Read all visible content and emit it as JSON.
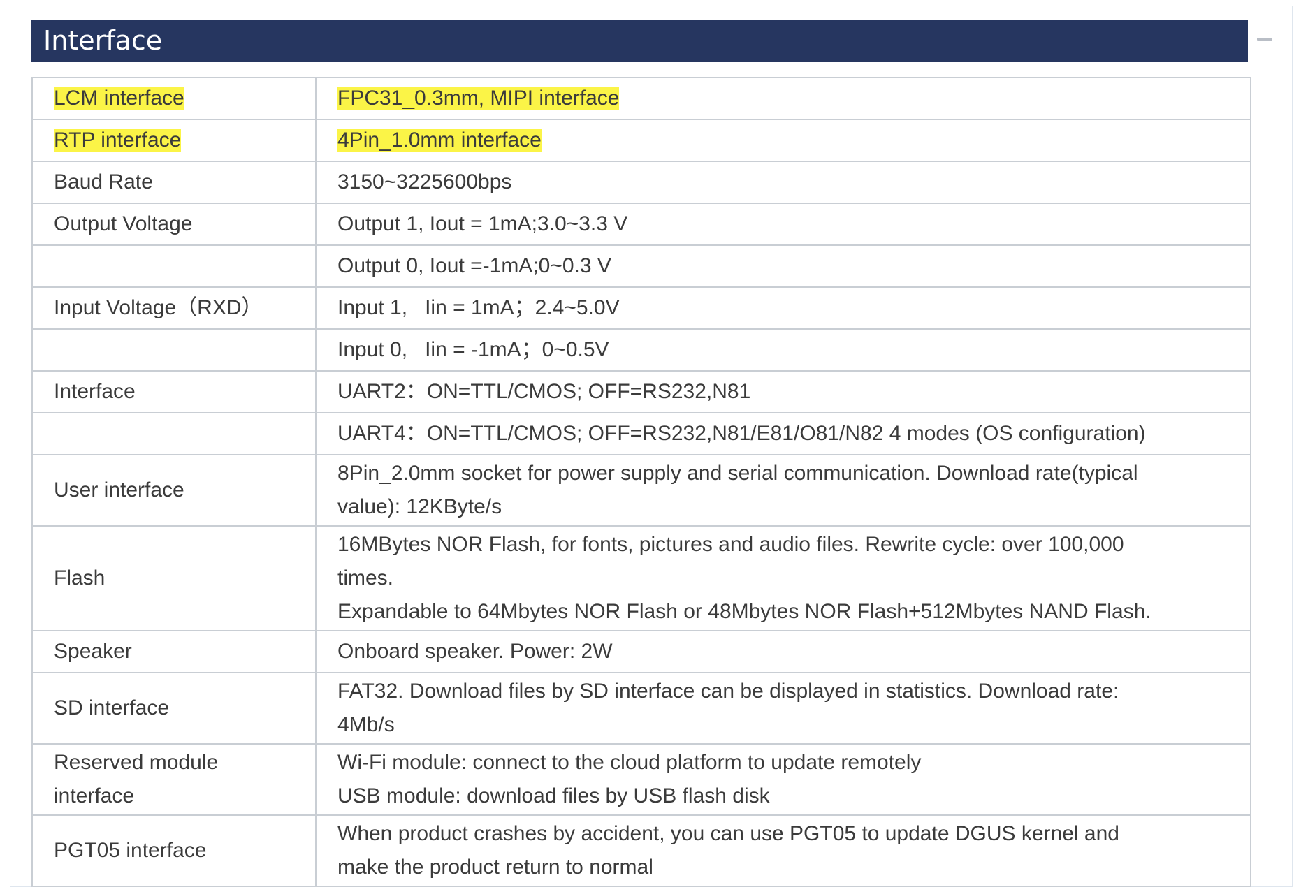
{
  "section": {
    "title": "Interface",
    "collapse_icon": "minus-icon"
  },
  "rows": [
    {
      "label": "LCM interface",
      "value": "FPC31_0.3mm, MIPI interface",
      "highlight": true
    },
    {
      "label": "RTP interface",
      "value": "4Pin_1.0mm interface",
      "highlight": true
    },
    {
      "label": "Baud Rate",
      "value": "3150~3225600bps"
    },
    {
      "label": "Output Voltage",
      "value": "Output 1, Iout = 1mA;3.0~3.3 V"
    },
    {
      "label": "",
      "value": "Output 0, Iout =-1mA;0~0.3 V"
    },
    {
      "label": "Input Voltage（RXD）",
      "value": "Input 1,   Iin = 1mA；2.4~5.0V"
    },
    {
      "label": "",
      "value": "Input 0,   Iin = -1mA；0~0.5V"
    },
    {
      "label": "Interface",
      "value": "UART2：ON=TTL/CMOS; OFF=RS232,N81"
    },
    {
      "label": "",
      "value": "UART4：ON=TTL/CMOS; OFF=RS232,N81/E81/O81/N82 4 modes (OS configuration)"
    },
    {
      "label": "User interface",
      "lines": [
        "8Pin_2.0mm socket for power supply and serial communication. Download rate(typical",
        "value): 12KByte/s"
      ]
    },
    {
      "label": "Flash",
      "lines": [
        "16MBytes NOR Flash, for fonts, pictures and audio files. Rewrite cycle: over 100,000",
        "times.",
        "Expandable to 64Mbytes NOR Flash or 48Mbytes NOR Flash+512Mbytes NAND Flash."
      ]
    },
    {
      "label": "Speaker",
      "value": "Onboard speaker. Power: 2W"
    },
    {
      "label": "SD interface",
      "lines": [
        "FAT32. Download files by SD interface can be displayed in statistics. Download rate:",
        "4Mb/s"
      ]
    },
    {
      "label_lines": [
        "Reserved module",
        "interface"
      ],
      "lines": [
        "Wi-Fi module: connect to the cloud platform to update remotely",
        "USB module: download files by USB flash disk"
      ]
    },
    {
      "label": "PGT05 interface",
      "lines": [
        "When product crashes by accident, you can use PGT05 to update DGUS kernel and",
        "make the product return to normal"
      ]
    }
  ],
  "colors": {
    "header_bg": "#263660",
    "highlight": "#fbf447",
    "border": "#c9ced4",
    "text": "#3b3b3b"
  }
}
